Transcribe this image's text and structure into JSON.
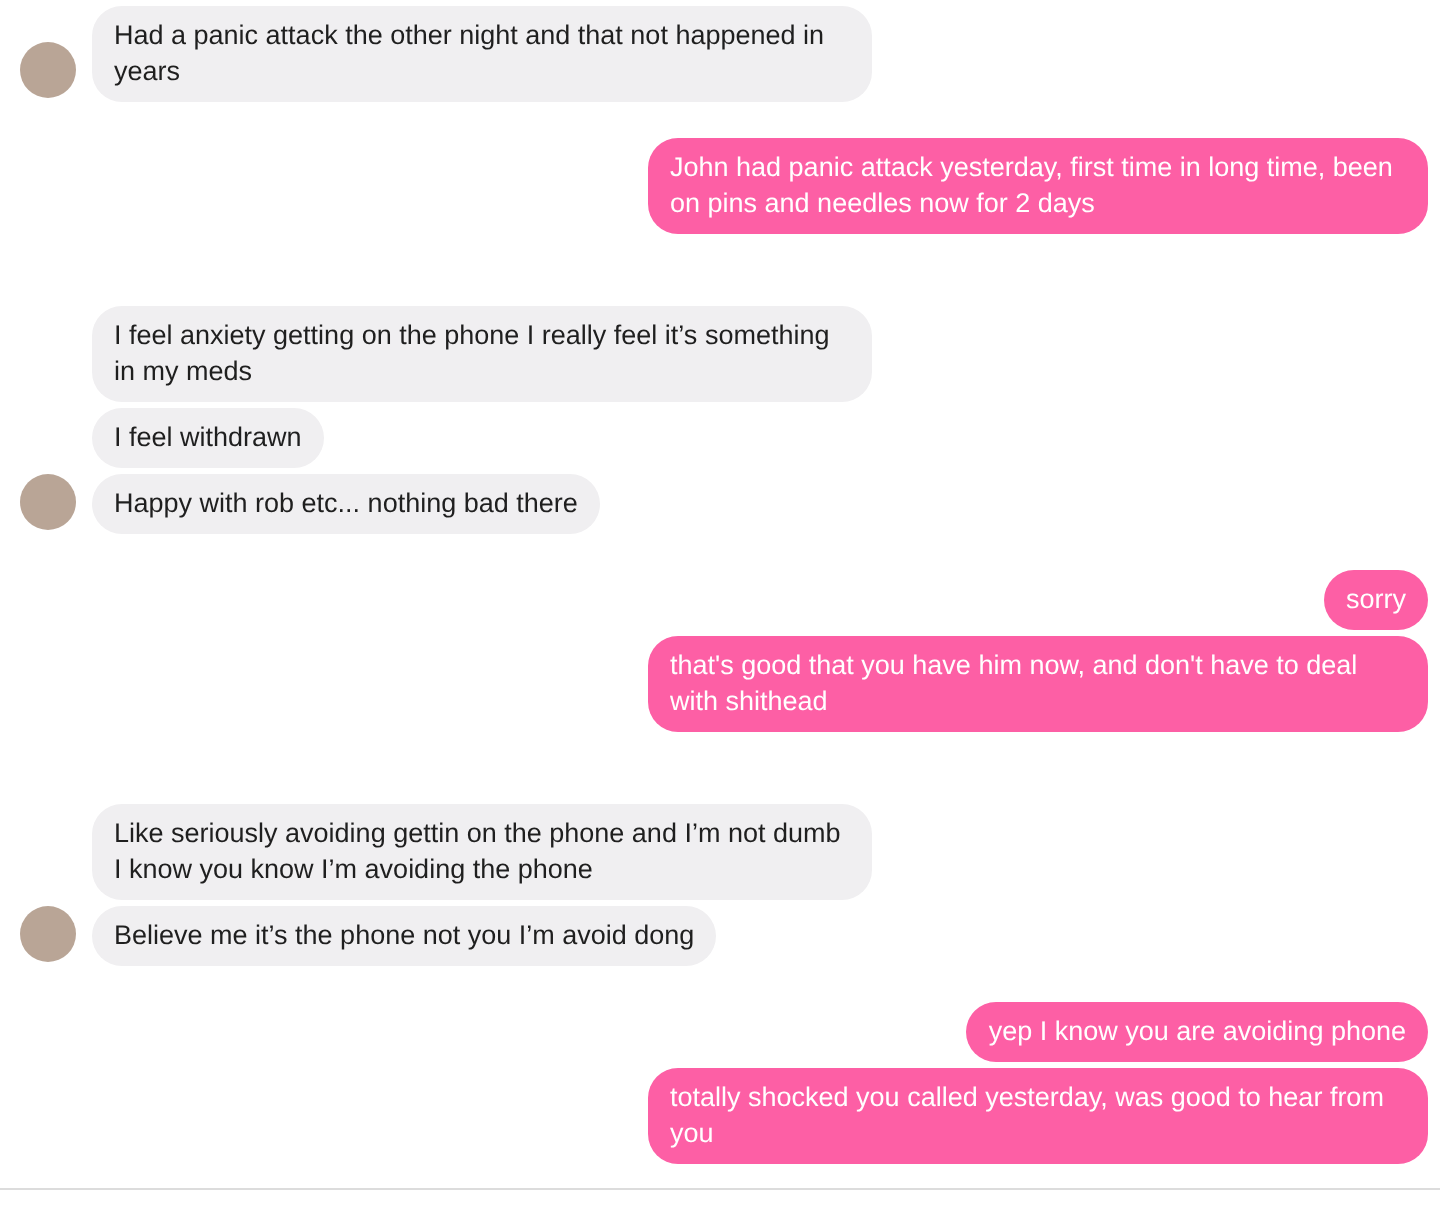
{
  "messages": [
    {
      "kind": "incoming",
      "bubbles": [
        "Had a panic attack the other night and that not happened in years"
      ]
    },
    {
      "kind": "outgoing",
      "bubbles": [
        "John had panic attack yesterday, first time in long time, been on pins and needles now for 2 days"
      ]
    },
    {
      "kind": "incoming",
      "bubbles": [
        "I feel anxiety getting on the phone I really feel it’s something in my meds",
        "I feel withdrawn",
        "Happy with rob etc... nothing bad there"
      ]
    },
    {
      "kind": "outgoing",
      "bubbles": [
        "sorry",
        "that's good that you have him now, and don't have to deal with shithead"
      ]
    },
    {
      "kind": "incoming",
      "bubbles": [
        "Like seriously avoiding gettin on the phone and I’m not dumb I know you know I’m avoiding the phone",
        "Believe me it’s the phone not you I’m avoid dong"
      ]
    },
    {
      "kind": "outgoing",
      "bubbles": [
        "yep I know you are avoiding phone",
        "totally shocked you called yesterday, was good to hear from you"
      ]
    }
  ]
}
